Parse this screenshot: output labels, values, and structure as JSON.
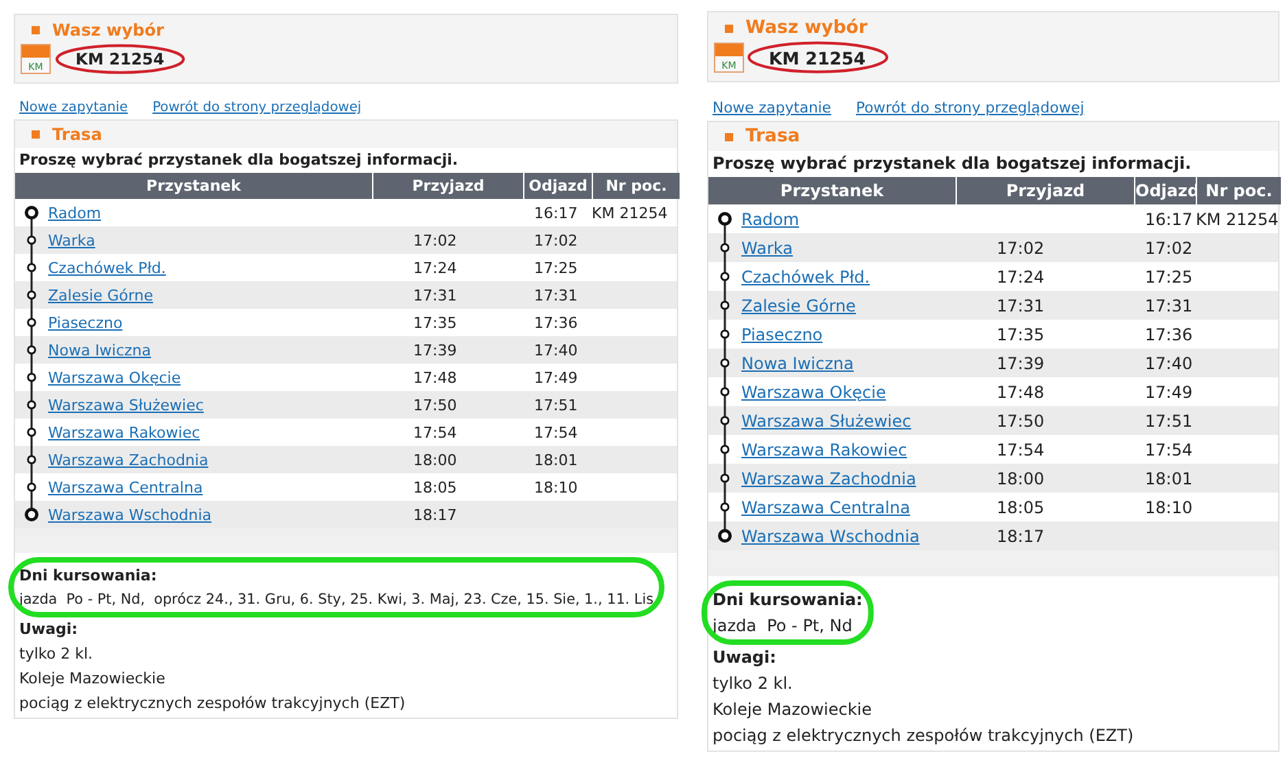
{
  "panels": [
    {
      "selection": {
        "title": "Wasz wybór",
        "logo_text": "KM",
        "train": "KM 21254"
      },
      "links": [
        "Nowe zapytanie",
        "Powrót do strony przeglądowej"
      ],
      "route": {
        "title": "Trasa",
        "instruction": "Proszę wybrać przystanek dla bogatszej informacji.",
        "columns": [
          "Przystanek",
          "Przyjazd",
          "Odjazd",
          "Nr poc."
        ],
        "stops": [
          {
            "kind": "terminal",
            "name": "Radom",
            "departure": "16:17",
            "train": "KM 21254"
          },
          {
            "kind": "intermediate",
            "name": "Warka",
            "arrival": "17:02",
            "departure": "17:02"
          },
          {
            "kind": "intermediate",
            "name": "Czachówek Płd.",
            "arrival": "17:24",
            "departure": "17:25"
          },
          {
            "kind": "intermediate",
            "name": "Zalesie Górne",
            "arrival": "17:31",
            "departure": "17:31"
          },
          {
            "kind": "intermediate",
            "name": "Piaseczno",
            "arrival": "17:35",
            "departure": "17:36"
          },
          {
            "kind": "intermediate",
            "name": "Nowa Iwiczna",
            "arrival": "17:39",
            "departure": "17:40"
          },
          {
            "kind": "intermediate",
            "name": "Warszawa Okęcie",
            "arrival": "17:48",
            "departure": "17:49"
          },
          {
            "kind": "intermediate",
            "name": "Warszawa Służewiec",
            "arrival": "17:50",
            "departure": "17:51"
          },
          {
            "kind": "intermediate",
            "name": "Warszawa Rakowiec",
            "arrival": "17:54",
            "departure": "17:54"
          },
          {
            "kind": "intermediate",
            "name": "Warszawa Zachodnia",
            "arrival": "18:00",
            "departure": "18:01"
          },
          {
            "kind": "intermediate",
            "name": "Warszawa Centralna",
            "arrival": "18:05",
            "departure": "18:10"
          },
          {
            "kind": "terminal",
            "name": "Warszawa Wschodnia",
            "arrival": "18:17"
          }
        ]
      },
      "days": {
        "label": "Dni kursowania:",
        "text": "jazda  Po - Pt, Nd,  oprócz 24., 31. Gru, 6. Sty, 25. Kwi, 3. Maj, 23. Cze, 15. Sie, 1., 11. Lis"
      },
      "remarks": {
        "label": "Uwagi:",
        "items": [
          "tylko 2 kl.",
          "Koleje Mazowieckie",
          "pociąg z elektrycznych zespołów trakcyjnych (EZT)"
        ]
      }
    },
    {
      "selection": {
        "title": "Wasz wybór",
        "logo_text": "KM",
        "train": "KM 21254"
      },
      "links": [
        "Nowe zapytanie",
        "Powrót do strony przeglądowej"
      ],
      "route": {
        "title": "Trasa",
        "instruction": "Proszę wybrać przystanek dla bogatszej informacji.",
        "columns": [
          "Przystanek",
          "Przyjazd",
          "Odjazd",
          "Nr poc."
        ],
        "stops": [
          {
            "kind": "terminal",
            "name": "Radom",
            "departure": "16:17",
            "train": "KM 21254"
          },
          {
            "kind": "intermediate",
            "name": "Warka",
            "arrival": "17:02",
            "departure": "17:02"
          },
          {
            "kind": "intermediate",
            "name": "Czachówek Płd.",
            "arrival": "17:24",
            "departure": "17:25"
          },
          {
            "kind": "intermediate",
            "name": "Zalesie Górne",
            "arrival": "17:31",
            "departure": "17:31"
          },
          {
            "kind": "intermediate",
            "name": "Piaseczno",
            "arrival": "17:35",
            "departure": "17:36"
          },
          {
            "kind": "intermediate",
            "name": "Nowa Iwiczna",
            "arrival": "17:39",
            "departure": "17:40"
          },
          {
            "kind": "intermediate",
            "name": "Warszawa Okęcie",
            "arrival": "17:48",
            "departure": "17:49"
          },
          {
            "kind": "intermediate",
            "name": "Warszawa Służewiec",
            "arrival": "17:50",
            "departure": "17:51"
          },
          {
            "kind": "intermediate",
            "name": "Warszawa Rakowiec",
            "arrival": "17:54",
            "departure": "17:54"
          },
          {
            "kind": "intermediate",
            "name": "Warszawa Zachodnia",
            "arrival": "18:00",
            "departure": "18:01"
          },
          {
            "kind": "intermediate",
            "name": "Warszawa Centralna",
            "arrival": "18:05",
            "departure": "18:10"
          },
          {
            "kind": "terminal",
            "name": "Warszawa Wschodnia",
            "arrival": "18:17"
          }
        ]
      },
      "days": {
        "label": "Dni kursowania:",
        "text": "jazda  Po - Pt, Nd"
      },
      "remarks": {
        "label": "Uwagi:",
        "items": [
          "tylko 2 kl.",
          "Koleje Mazowieckie",
          "pociąg z elektrycznych zespołów trakcyjnych (EZT)"
        ]
      }
    }
  ]
}
